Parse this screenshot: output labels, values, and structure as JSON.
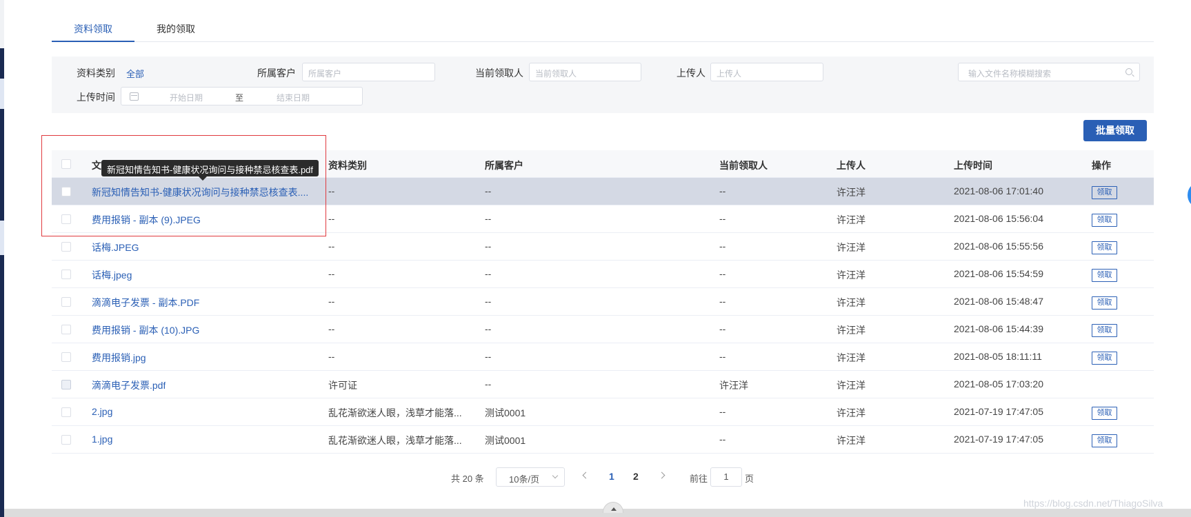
{
  "tabs": [
    {
      "label": "资料领取",
      "active": true
    },
    {
      "label": "我的领取",
      "active": false
    }
  ],
  "filters": {
    "category_label": "资料类别",
    "category_value": "全部",
    "customer_label": "所属客户",
    "customer_placeholder": "所属客户",
    "receiver_label": "当前领取人",
    "receiver_placeholder": "当前领取人",
    "uploader_label": "上传人",
    "uploader_placeholder": "上传人",
    "search_placeholder": "输入文件名称模糊搜索",
    "upload_time_label": "上传时间",
    "start_date_placeholder": "开始日期",
    "range_separator": "至",
    "end_date_placeholder": "结束日期"
  },
  "batch_button_label": "批量领取",
  "table": {
    "columns": [
      "文",
      "资料类别",
      "所属客户",
      "当前领取人",
      "上传人",
      "上传时间",
      "操作"
    ],
    "rows": [
      {
        "name": "新冠知情告知书-健康状况询问与接种禁忌核查表....",
        "category": "--",
        "customer": "--",
        "receiver": "--",
        "uploader": "许汪洋",
        "time": "2021-08-06 17:01:40",
        "action": "领取",
        "disabled": false
      },
      {
        "name": "费用报销 - 副本 (9).JPEG",
        "category": "--",
        "customer": "--",
        "receiver": "--",
        "uploader": "许汪洋",
        "time": "2021-08-06 15:56:04",
        "action": "领取",
        "disabled": false
      },
      {
        "name": "话梅.JPEG",
        "category": "--",
        "customer": "--",
        "receiver": "--",
        "uploader": "许汪洋",
        "time": "2021-08-06 15:55:56",
        "action": "领取",
        "disabled": false
      },
      {
        "name": "话梅.jpeg",
        "category": "--",
        "customer": "--",
        "receiver": "--",
        "uploader": "许汪洋",
        "time": "2021-08-06 15:54:59",
        "action": "领取",
        "disabled": false
      },
      {
        "name": "滴滴电子发票 - 副本.PDF",
        "category": "--",
        "customer": "--",
        "receiver": "--",
        "uploader": "许汪洋",
        "time": "2021-08-06 15:48:47",
        "action": "领取",
        "disabled": false
      },
      {
        "name": "费用报销 - 副本 (10).JPG",
        "category": "--",
        "customer": "--",
        "receiver": "--",
        "uploader": "许汪洋",
        "time": "2021-08-06 15:44:39",
        "action": "领取",
        "disabled": false
      },
      {
        "name": "费用报销.jpg",
        "category": "--",
        "customer": "--",
        "receiver": "--",
        "uploader": "许汪洋",
        "time": "2021-08-05 18:11:11",
        "action": "领取",
        "disabled": false
      },
      {
        "name": "滴滴电子发票.pdf",
        "category": "许可证",
        "customer": "--",
        "receiver": "许汪洋",
        "uploader": "许汪洋",
        "time": "2021-08-05 17:03:20",
        "action": "",
        "disabled": true
      },
      {
        "name": "2.jpg",
        "category": "乱花渐欲迷人眼，浅草才能落...",
        "customer": "测试0001",
        "receiver": "--",
        "uploader": "许汪洋",
        "time": "2021-07-19 17:47:05",
        "action": "领取",
        "disabled": false
      },
      {
        "name": "1.jpg",
        "category": "乱花渐欲迷人眼，浅草才能落...",
        "customer": "测试0001",
        "receiver": "--",
        "uploader": "许汪洋",
        "time": "2021-07-19 17:47:05",
        "action": "领取",
        "disabled": false
      }
    ]
  },
  "tooltip_text": "新冠知情告知书-健康状况询问与接种禁忌核查表.pdf",
  "pagination": {
    "total_text": "共 20 条",
    "page_size": "10条/页",
    "pages": [
      "1",
      "2"
    ],
    "current_page": "1",
    "goto_label": "前往",
    "goto_value": "1",
    "page_suffix": "页"
  },
  "watermark": "https://blog.csdn.net/ThiagoSilva",
  "colors": {
    "accent": "#2a5fb5",
    "highlight_row": "#d4d9e4",
    "annotation": "#e0393e"
  }
}
